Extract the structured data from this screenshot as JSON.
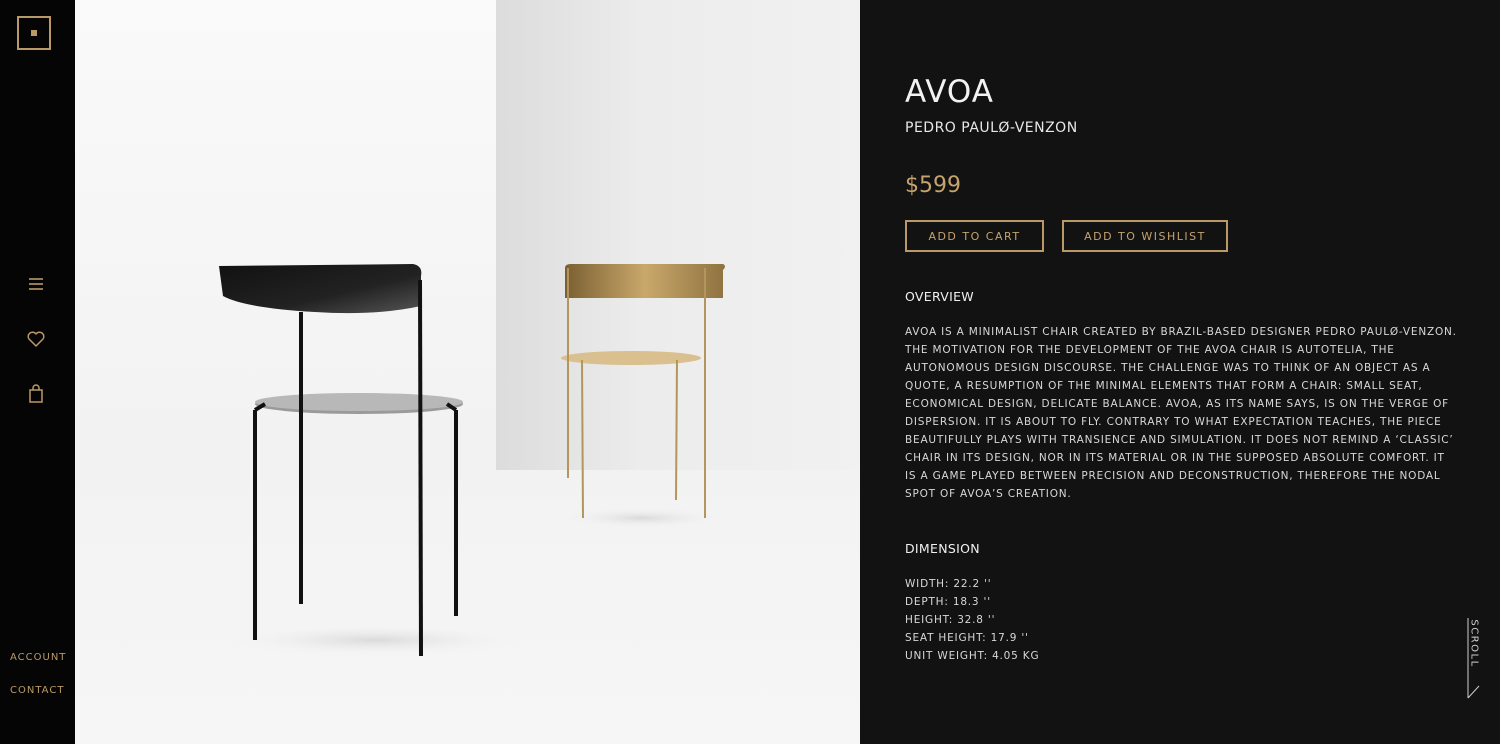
{
  "sidebar": {
    "logo": "logo-square",
    "icons": [
      "menu-icon",
      "heart-icon",
      "shopping-bag-icon"
    ],
    "account_label": "ACCOUNT",
    "contact_label": "CONTACT"
  },
  "product": {
    "name": "AVOA",
    "designer": "PEDRO PAULØ-VENZON",
    "price": "$599",
    "add_to_cart_label": "ADD TO CART",
    "add_to_wishlist_label": "ADD TO WISHLIST",
    "overview_heading": "OVERVIEW",
    "overview_text": "AVOA IS A MINIMALIST CHAIR CREATED BY BRAZIL-BASED DESIGNER PEDRO PAULØ-VENZON. THE MOTIVATION FOR THE DEVELOPMENT OF THE AVOA CHAIR IS AUTOTELIA, THE AUTONOMOUS DESIGN DISCOURSE. THE CHALLENGE WAS TO THINK OF AN OBJECT AS A QUOTE, A RESUMPTION OF THE MINIMAL ELEMENTS THAT FORM A CHAIR: SMALL SEAT, ECONOMICAL DESIGN, DELICATE BALANCE. AVOA, AS ITS NAME SAYS, IS ON THE VERGE OF DISPERSION. IT IS ABOUT TO FLY. CONTRARY TO WHAT EXPECTATION TEACHES, THE PIECE BEAUTIFULLY PLAYS WITH TRANSIENCE AND SIMULATION. IT DOES NOT REMIND A ‘CLASSIC’ CHAIR IN ITS DESIGN, NOR IN ITS MATERIAL OR IN THE SUPPOSED ABSOLUTE COMFORT. IT IS A GAME PLAYED BETWEEN PRECISION AND DECONSTRUCTION, THEREFORE THE NODAL SPOT OF AVOA’S CREATION.",
    "dimension_heading": "DIMENSION",
    "dimensions": [
      "WIDTH: 22.2 ''",
      "DEPTH: 18.3 ''",
      "HEIGHT: 32.8 ''",
      "SEAT HEIGHT: 17.9 ''",
      "UNIT WEIGHT: 4.05 KG"
    ]
  },
  "scroll_label": "SCROLL",
  "colors": {
    "accent": "#b99a66",
    "panel_bg": "#121212",
    "sidebar_bg": "#050505"
  }
}
